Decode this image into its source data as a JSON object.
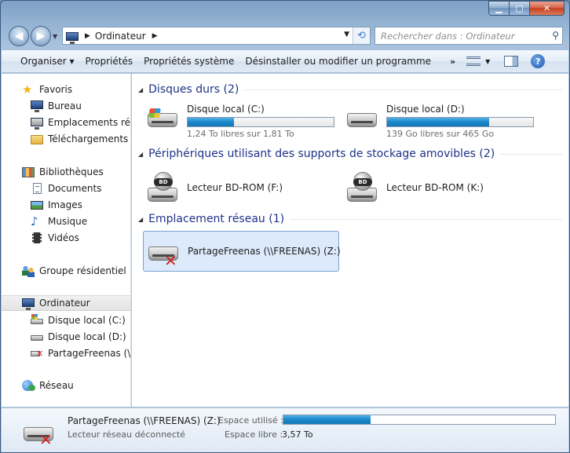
{
  "window": {
    "caption_buttons": {
      "minimize": "▁",
      "maximize": "▢",
      "close": "✕"
    }
  },
  "address_bar": {
    "crumbs": [
      "Ordinateur"
    ],
    "search_placeholder": "Rechercher dans : Ordinateur"
  },
  "toolbar": {
    "items": [
      "Organiser ▾",
      "Propriétés",
      "Propriétés système",
      "Désinstaller ou modifier un programme"
    ],
    "more": "»"
  },
  "sidebar": {
    "favorites": {
      "label": "Favoris",
      "items": [
        "Bureau",
        "Emplacements récents",
        "Téléchargements"
      ]
    },
    "libraries": {
      "label": "Bibliothèques",
      "items": [
        "Documents",
        "Images",
        "Musique",
        "Vidéos"
      ]
    },
    "homegroup": "Groupe résidentiel",
    "computer": {
      "label": "Ordinateur",
      "items": [
        "Disque local (C:)",
        "Disque local (D:)",
        "PartageFreenas (\\\\FREENAS) (Z:)"
      ]
    },
    "network": "Réseau"
  },
  "groups": {
    "hard_disks": {
      "header": "Disques durs (2)",
      "drives": [
        {
          "name": "Disque local (C:)",
          "free_text": "1,24 To libres sur 1,81 To",
          "used_fraction": 0.315
        },
        {
          "name": "Disque local (D:)",
          "free_text": "139 Go libres sur 465 Go",
          "used_fraction": 0.7
        }
      ]
    },
    "removable": {
      "header": "Périphériques utilisant des supports de stockage amovibles (2)",
      "drives": [
        {
          "name": "Lecteur BD-ROM (F:)",
          "badge": "BD"
        },
        {
          "name": "Lecteur BD-ROM (K:)",
          "badge": "BD"
        }
      ]
    },
    "network": {
      "header": "Emplacement réseau (1)",
      "drives": [
        {
          "name": "PartageFreenas (\\\\FREENAS) (Z:)"
        }
      ]
    }
  },
  "details": {
    "name": "PartageFreenas (\\\\FREENAS) (Z:)",
    "status": "Lecteur réseau déconnecté",
    "used_label": "Espace utilisé :",
    "free_label": "Espace libre :",
    "free_value": "3,57 To",
    "used_fraction": 0.32
  },
  "colors": {
    "group_header": "#1e3287",
    "bar_fill": "#1b87c9",
    "selection": "#dceafc"
  }
}
